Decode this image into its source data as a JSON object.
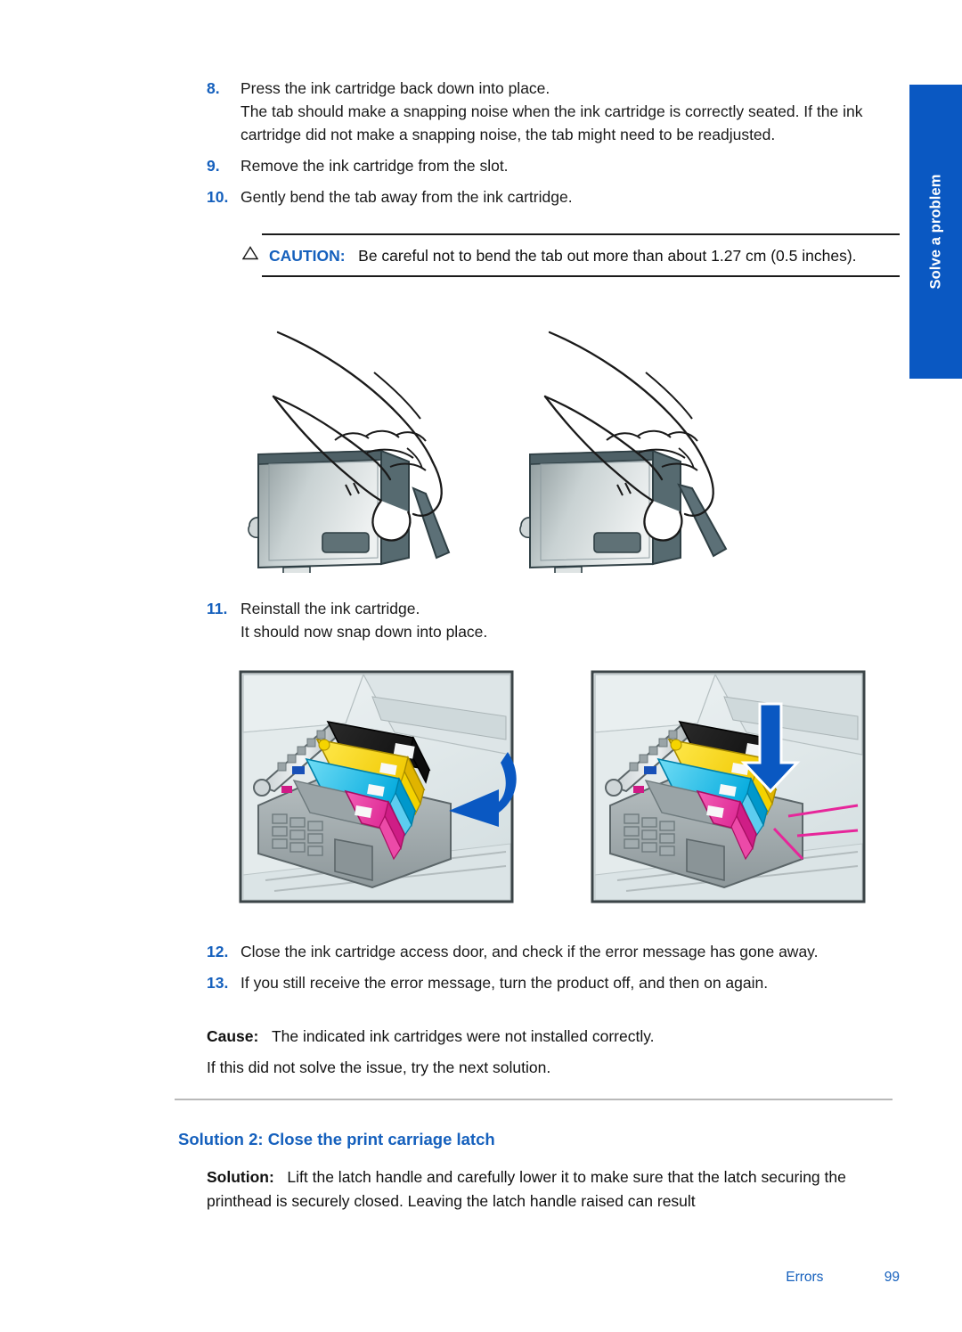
{
  "side_tab": {
    "label": "Solve a problem",
    "color": "#0a58c2"
  },
  "colors": {
    "accent_blue": "#1560bd",
    "divider_gray": "#b9b9b9",
    "text": "#1a1a1a"
  },
  "steps": [
    {
      "number": "8.",
      "lines": [
        "Press the ink cartridge back down into place.",
        "The tab should make a snapping noise when the ink cartridge is correctly seated. If the ink cartridge did not make a snapping noise, the tab might need to be readjusted."
      ]
    },
    {
      "number": "9.",
      "lines": [
        "Remove the ink cartridge from the slot."
      ]
    },
    {
      "number": "10.",
      "lines": [
        "Gently bend the tab away from the ink cartridge."
      ]
    }
  ],
  "caution": {
    "icon": "warning-triangle",
    "label": "CAUTION:",
    "text": "Be careful not to bend the tab out more than about 1.27 cm (0.5 inches)."
  },
  "figure_hands": {
    "caption": "",
    "panels": [
      {
        "name": "cartridge-tab-press-left"
      },
      {
        "name": "cartridge-tab-bend-right"
      }
    ]
  },
  "steps2": [
    {
      "number": "11.",
      "lines": [
        "Reinstall the ink cartridge.",
        "It should now snap down into place."
      ]
    }
  ],
  "figure_carriages": {
    "panels": [
      {
        "name": "carriage-insert-arrow-left",
        "arrow_color": "#0a58c2"
      },
      {
        "name": "carriage-seated-callouts-right",
        "arrow_color": "#0a58c2",
        "callout_color": "#e6269a"
      }
    ],
    "cartridge_colors": [
      "#1a1a1a",
      "#f5d800",
      "#00b2e3",
      "#e6269a"
    ]
  },
  "steps3": [
    {
      "number": "12.",
      "lines": [
        "Close the ink cartridge access door, and check if the error message has gone away."
      ]
    },
    {
      "number": "13.",
      "lines": [
        "If you still receive the error message, turn the product off, and then on again."
      ]
    }
  ],
  "cause": {
    "label": "Cause:",
    "text": "The indicated ink cartridges were not installed correctly."
  },
  "next_solution": "If this did not solve the issue, try the next solution.",
  "solution_heading": "Solution 2: Close the print carriage latch",
  "solution_body": {
    "label": "Solution:",
    "text": "Lift the latch handle and carefully lower it to make sure that the latch securing the printhead is securely closed. Leaving the latch handle raised can result"
  },
  "footer": {
    "section": "Errors",
    "page": "99"
  }
}
